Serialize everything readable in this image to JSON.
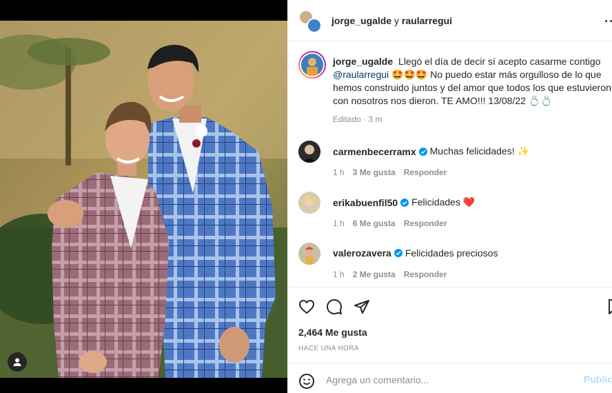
{
  "post": {
    "header": {
      "author": "jorge_ugalde",
      "conjunction": "y",
      "collaborator": "raularregui",
      "more_label": "··"
    },
    "caption": {
      "username": "jorge_ugalde",
      "text_before_mention": "Llegó el día de decir sí acepto casarme contigo",
      "mention": "@raularregui",
      "text_after_mention": "🤩🤩🤩 No puedo estar más orgulloso de lo que hemos construido juntos y del amor que todos los que estuvieron con nosotros nos dieron. TE AMO!!! 13/08/22 💍💍",
      "edited_label": "Editado",
      "separator": "·",
      "time": "3 m"
    },
    "comments": [
      {
        "username": "carmenbecerramx",
        "verified": true,
        "text": "Muchas felicidades! ✨",
        "time": "1 h",
        "likes": "3 Me gusta",
        "reply_label": "Responder"
      },
      {
        "username": "erikabuenfil50",
        "verified": true,
        "text": "Felicidades ❤️",
        "time": "1 h",
        "likes": "6 Me gusta",
        "reply_label": "Responder"
      },
      {
        "username": "valerozavera",
        "verified": true,
        "text": "Felicidades preciosos",
        "time": "1 h",
        "likes": "2 Me gusta",
        "reply_label": "Responder"
      }
    ],
    "likes_label": "2,464 Me gusta",
    "time_ago": "HACE UNA HORA",
    "add_comment": {
      "placeholder": "Agrega un comentario...",
      "publish_label": "Publicar"
    }
  },
  "icons": {
    "tag": "user-tag-icon",
    "like": "heart-icon",
    "comment": "comment-icon",
    "share": "paper-plane-icon",
    "save": "bookmark-icon",
    "emoji": "emoji-icon",
    "verified": "verified-badge-icon"
  },
  "colors": {
    "verified": "#0095f6",
    "mention": "#00376b",
    "muted": "#8e8e8e",
    "publish": "#b2dffc"
  }
}
